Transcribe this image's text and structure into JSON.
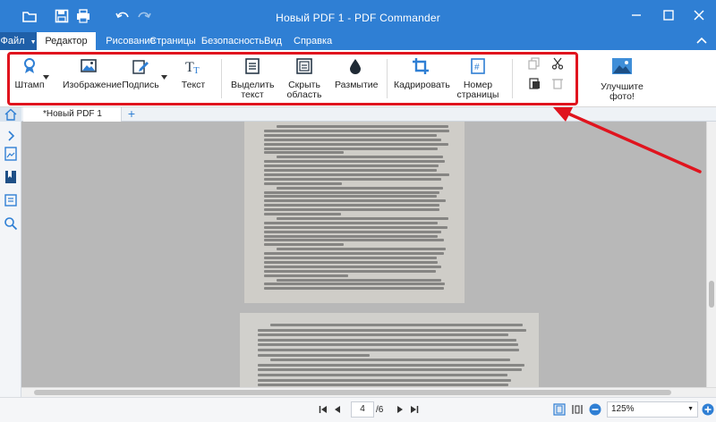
{
  "window": {
    "title": "Новый PDF 1 - PDF Commander"
  },
  "menu": {
    "file": "Файл",
    "items": [
      "Редактор",
      "Рисование",
      "Страницы",
      "Безопасность",
      "Вид",
      "Справка"
    ],
    "active": "Редактор"
  },
  "ribbon": {
    "stamp": "Штамп",
    "image": "Изображение",
    "signature": "Подпись",
    "text": "Текст",
    "select_text_1": "Выделить",
    "select_text_2": "текст",
    "hide_area_1": "Скрыть",
    "hide_area_2": "область",
    "blur": "Размытие",
    "crop": "Кадрировать",
    "page_number_1": "Номер",
    "page_number_2": "страницы",
    "improve_photo": "Улучшите фото!"
  },
  "tabs": {
    "doc_tab": "*Новый PDF 1",
    "add": "+"
  },
  "status": {
    "current_page": "4",
    "total_pages": "/6",
    "zoom": "125%"
  },
  "colors": {
    "accent": "#2f7fd4",
    "highlight": "#e0141e"
  },
  "icons": [
    "folder-icon",
    "save-icon",
    "print-icon",
    "undo-icon",
    "redo-icon",
    "stamp-icon",
    "image-icon",
    "signature-icon",
    "text-icon",
    "select-text-icon",
    "hide-area-icon",
    "blur-icon",
    "crop-icon",
    "page-number-icon",
    "copy-icon",
    "cut-icon",
    "paste-icon",
    "delete-icon",
    "photo-icon",
    "home-icon",
    "annotation-arrow"
  ]
}
